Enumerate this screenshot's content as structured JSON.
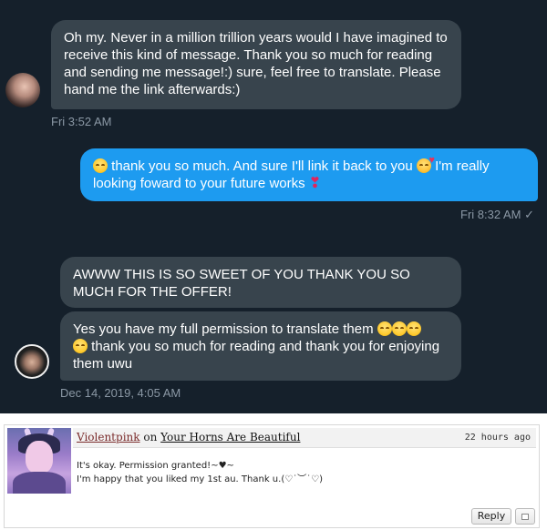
{
  "chat1": {
    "incoming_message": "Oh my. Never in a million trillion years would I have imagined to receive this kind of message. Thank you so much for reading and sending me message!:) sure, feel free to translate. Please hand me the link afterwards:)",
    "incoming_time": "Fri 3:52 AM",
    "outgoing_part1": "thank you so much. And sure I'll link it back to you",
    "outgoing_part2": "I'm really looking foward to your future works",
    "outgoing_time": "Fri 8:32 AM ✓"
  },
  "chat2": {
    "message1": "AWWW THIS IS SO SWEET OF YOU THANK YOU SO MUCH FOR THE OFFER!",
    "message2_part1": "Yes you have my full permission to translate them",
    "message2_part2": "thank you so much for reading and thank you for enjoying them uwu",
    "time": "Dec 14, 2019, 4:05 AM"
  },
  "comment": {
    "username": "Violentpink",
    "on_text": "on",
    "work_title": "Your Horns Are Beautiful",
    "time_ago": "22 hours ago",
    "line1": "It's okay. Permission granted!~♥~",
    "line2": "I'm happy that you liked my 1st au. Thank u.(♡˙︶˙♡)",
    "reply_label": "Reply"
  },
  "colors": {
    "dark_bg": "#15202b",
    "incoming_bubble": "#38444d",
    "outgoing_bubble": "#1d9bf0",
    "timestamp": "#8b98a5"
  },
  "icons": [
    "smiling-face-emoji",
    "smiling-face-with-hearts-emoji",
    "red-heart-emoji",
    "checkmark-icon"
  ]
}
